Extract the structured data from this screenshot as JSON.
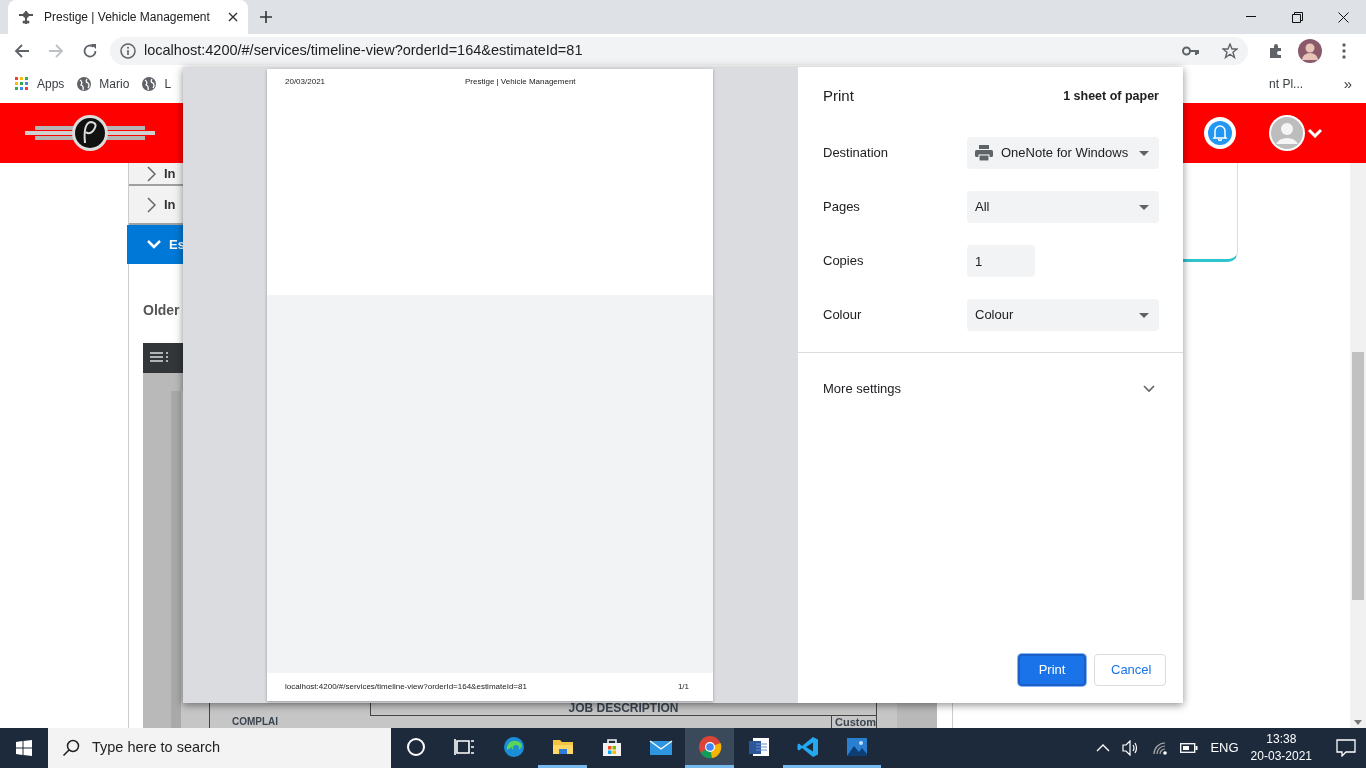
{
  "browser": {
    "tab_title": "Prestige | Vehicle Management",
    "address": "localhost:4200/#/services/timeline-view?orderId=164&estimateId=81",
    "bookmarks": [
      {
        "label": "Apps",
        "kind": "apps"
      },
      {
        "label": "Mario",
        "kind": "globe"
      },
      {
        "label": "L",
        "kind": "globe"
      }
    ],
    "bookmark_cut": "nt Pl...",
    "bookmark_more": "»"
  },
  "app": {
    "accordion": [
      {
        "label": "In",
        "expanded": false
      },
      {
        "label": "In",
        "expanded": false
      },
      {
        "label": "Es",
        "expanded": true
      }
    ],
    "section_title": "Older",
    "document": {
      "heading": "JOB DESCRIPTION",
      "column_1": "COMPLAI",
      "column_2": "Custom"
    }
  },
  "print_dialog": {
    "title": "Print",
    "sheets": "1 sheet of paper",
    "settings": [
      {
        "label": "Destination",
        "kind": "destination",
        "value": "OneNote for Windows"
      },
      {
        "label": "Pages",
        "kind": "select",
        "value": "All"
      },
      {
        "label": "Copies",
        "kind": "number",
        "value": "1"
      },
      {
        "label": "Colour",
        "kind": "select",
        "value": "Colour"
      }
    ],
    "more_settings": "More settings",
    "buttons": [
      {
        "label": "Print",
        "kind": "primary"
      },
      {
        "label": "Cancel",
        "kind": "secondary"
      }
    ],
    "preview": {
      "date": "20/03/2021",
      "title": "Prestige | Vehicle Management",
      "url": "localhost:4200/#/services/timeline-view?orderId=164&estimateId=81",
      "page": "1/1"
    }
  },
  "taskbar": {
    "search_placeholder": "Type here to search",
    "apps": [
      {
        "kind": "cortana",
        "running": false,
        "selected": false
      },
      {
        "kind": "taskview",
        "running": false,
        "selected": false
      },
      {
        "kind": "edge",
        "running": false,
        "selected": false
      },
      {
        "kind": "explorer",
        "running": true,
        "selected": false
      },
      {
        "kind": "store",
        "running": false,
        "selected": false
      },
      {
        "kind": "mail",
        "running": false,
        "selected": false
      },
      {
        "kind": "chrome",
        "running": true,
        "selected": true
      },
      {
        "kind": "word",
        "running": false,
        "selected": false
      },
      {
        "kind": "vscode",
        "running": true,
        "selected": false
      },
      {
        "kind": "photos",
        "running": true,
        "selected": false
      }
    ],
    "language": "ENG",
    "time": "13:38",
    "date": "20-03-2021"
  }
}
